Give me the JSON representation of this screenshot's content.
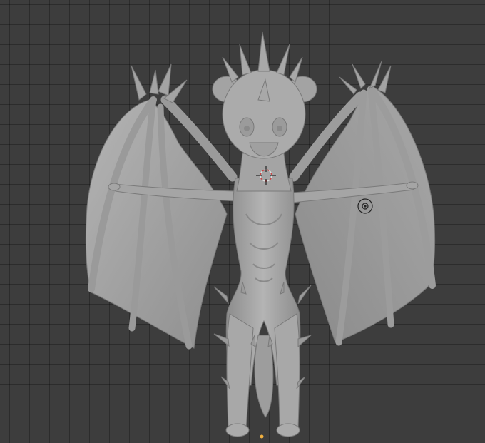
{
  "viewport": {
    "background": "#3d3d3d",
    "grid_line_color": "#303030",
    "axis_x_color": "#9a3b3b",
    "axis_y_color": "#3f6fa8",
    "model_color": "#a9a9a9",
    "model_shadow_color": "#7e7e7e",
    "cursor_color": "#e0e0e0",
    "cursor_accent": "#d04040"
  },
  "scene": {
    "object": "dragon-sculpt-mesh",
    "view": "front-orthographic",
    "shading": "solid"
  },
  "icons": {
    "cursor": "3d-cursor-icon",
    "origin": "object-origin-icon",
    "light": "light-gizmo-icon"
  }
}
